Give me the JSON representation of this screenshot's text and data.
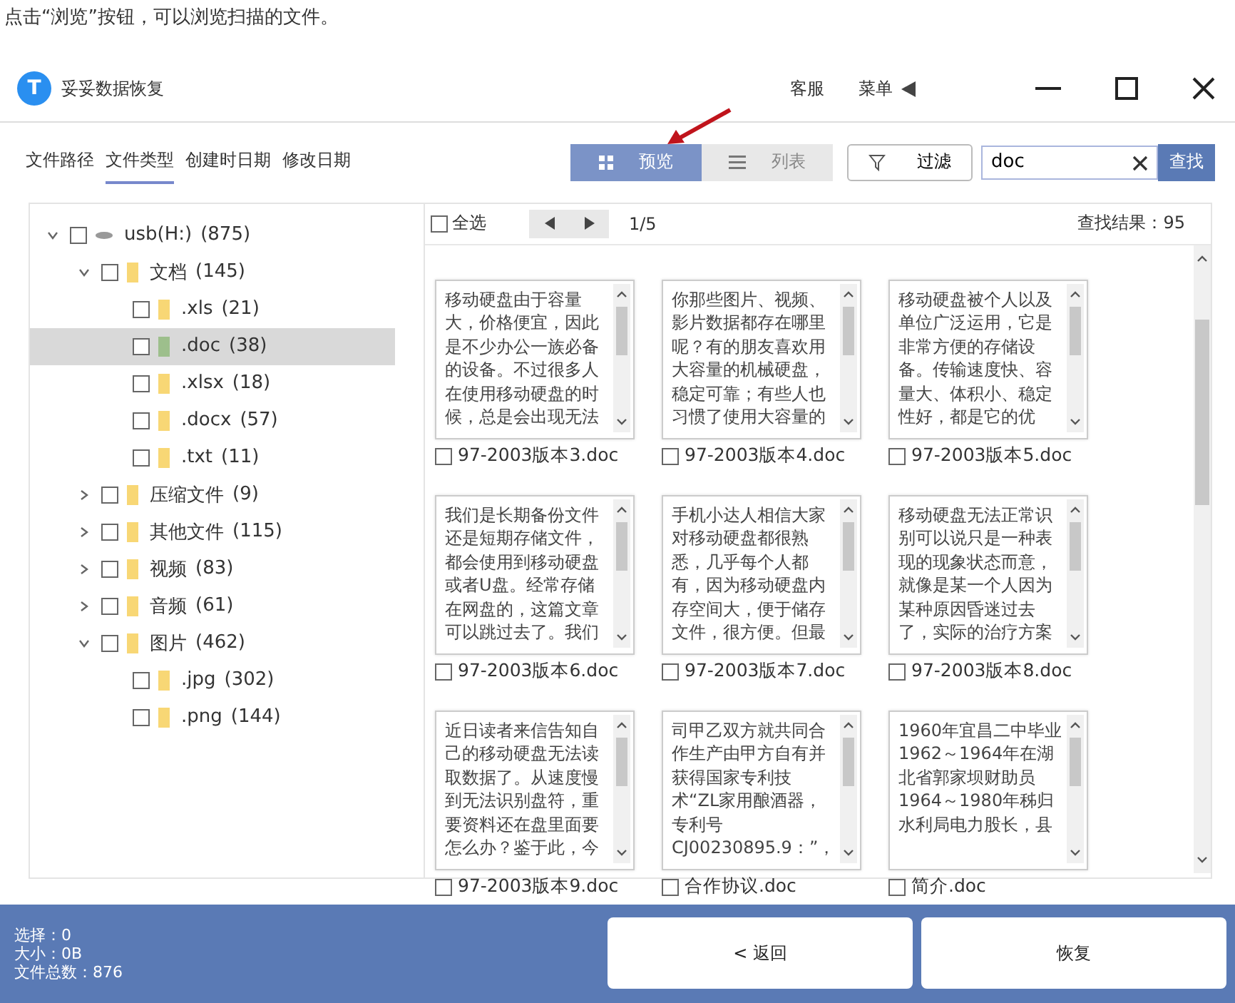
{
  "caption": "点击“浏览”按钮，可以浏览扫描的文件。",
  "window": {
    "logo_letter": "T",
    "title": "妥妥数据恢复",
    "support": "客服",
    "menu": "菜单"
  },
  "tabs": [
    {
      "label": "文件路径",
      "selected": false
    },
    {
      "label": "文件类型",
      "selected": true
    },
    {
      "label": "创建时日期",
      "selected": false
    },
    {
      "label": "修改日期",
      "selected": false
    }
  ],
  "view_toggle": [
    {
      "label": "预览",
      "kind": "grid",
      "selected": true
    },
    {
      "label": "列表",
      "kind": "list",
      "selected": false
    }
  ],
  "filter_button": "过滤",
  "search": {
    "value": "doc",
    "button": "查找"
  },
  "tree": [
    {
      "label": "usb(H:)",
      "count": "(875)",
      "kind": "drive",
      "expanded": true,
      "checked": false,
      "selected": false,
      "children": [
        {
          "label": "文档",
          "count": "(145)",
          "kind": "folder",
          "expanded": true,
          "checked": false,
          "selected": false,
          "children": [
            {
              "label": ".xls",
              "count": "(21)",
              "kind": "folder",
              "checked": false,
              "selected": false
            },
            {
              "label": ".doc",
              "count": "(38)",
              "kind": "folder",
              "checked": false,
              "selected": true
            },
            {
              "label": ".xlsx",
              "count": "(18)",
              "kind": "folder",
              "checked": false,
              "selected": false
            },
            {
              "label": ".docx",
              "count": "(57)",
              "kind": "folder",
              "checked": false,
              "selected": false
            },
            {
              "label": ".txt",
              "count": "(11)",
              "kind": "folder",
              "checked": false,
              "selected": false
            }
          ]
        },
        {
          "label": "压缩文件",
          "count": "(9)",
          "kind": "folder",
          "expanded": false,
          "checked": false,
          "selected": false
        },
        {
          "label": "其他文件",
          "count": "(115)",
          "kind": "folder",
          "expanded": false,
          "checked": false,
          "selected": false
        },
        {
          "label": "视频",
          "count": "(83)",
          "kind": "folder",
          "expanded": false,
          "checked": false,
          "selected": false
        },
        {
          "label": "音频",
          "count": "(61)",
          "kind": "folder",
          "expanded": false,
          "checked": false,
          "selected": false
        },
        {
          "label": "图片",
          "count": "(462)",
          "kind": "folder",
          "expanded": true,
          "checked": false,
          "selected": false,
          "children": [
            {
              "label": ".jpg",
              "count": "(302)",
              "kind": "folder",
              "checked": false,
              "selected": false
            },
            {
              "label": ".png",
              "count": "(144)",
              "kind": "folder",
              "checked": false,
              "selected": false
            }
          ]
        }
      ]
    }
  ],
  "results_bar": {
    "select_all": {
      "label": "全选",
      "checked": false
    },
    "page": "1/5",
    "result_count": "查找结果：95"
  },
  "files": [
    {
      "name": "97-2003版本3.doc",
      "checked": false,
      "preview": [
        "移动硬盘由于容量",
        "大，价格便宜，因此",
        "是不少办公一族必备",
        "的设备。不过很多人",
        "在使用移动硬盘的时",
        "候，总是会出现无法"
      ]
    },
    {
      "name": "97-2003版本4.doc",
      "checked": false,
      "preview": [
        "你那些图片、视频、",
        "影片数据都存在哪里",
        "呢？有的朋友喜欢用",
        "大容量的机械硬盘，",
        "稳定可靠；有些人也",
        "习惯了使用大容量的"
      ]
    },
    {
      "name": "97-2003版本5.doc",
      "checked": false,
      "preview": [
        "移动硬盘被个人以及",
        "单位广泛运用，它是",
        "非常方便的存储设",
        "备。传输速度快、容",
        "量大、体积小、稳定",
        "性好，都是它的优"
      ]
    },
    {
      "name": "97-2003版本6.doc",
      "checked": false,
      "preview": [
        "我们是长期备份文件",
        "还是短期存储文件，",
        "都会使用到移动硬盘",
        "或者U盘。经常存储",
        "在网盘的，这篇文章",
        "可以跳过去了。我们"
      ]
    },
    {
      "name": "97-2003版本7.doc",
      "checked": false,
      "preview": [
        "手机小达人相信大家",
        "对移动硬盘都很熟",
        "悉，几乎每个人都",
        "有，因为移动硬盘内",
        "存空间大，便于储存",
        "文件，很方便。但最"
      ]
    },
    {
      "name": "97-2003版本8.doc",
      "checked": false,
      "preview": [
        "移动硬盘无法正常识",
        "别可以说只是一种表",
        "现的现象状态而意，",
        "就像是某一个人因为",
        "某种原因昏迷过去",
        "了，实际的治疗方案"
      ]
    },
    {
      "name": "97-2003版本9.doc",
      "checked": false,
      "preview": [
        "近日读者来信告知自",
        "己的移动硬盘无法读",
        "取数据了。从速度慢",
        "到无法识别盘符，重",
        "要资料还在盘里面要",
        "怎么办？鉴于此，今"
      ]
    },
    {
      "name": "合作协议.doc",
      "checked": false,
      "preview": [
        "司甲乙双方就共同合",
        "作生产由甲方自有并",
        "获得国家专利技",
        "术“ZL家用酿酒器，",
        "专利号",
        "CJ00230895.9：”，"
      ]
    },
    {
      "name": "简介.doc",
      "checked": false,
      "preview": [
        "1960年宜昌二中毕业",
        "1962～1964年在湖",
        "北省郭家坝财助员",
        "1964～1980年秭归",
        "水利局电力股长，县"
      ]
    }
  ],
  "footer": {
    "stats": [
      "选择：0",
      "大小：0B",
      "文件总数：876"
    ],
    "back_button": "< 返回",
    "recover_button": "恢复"
  }
}
